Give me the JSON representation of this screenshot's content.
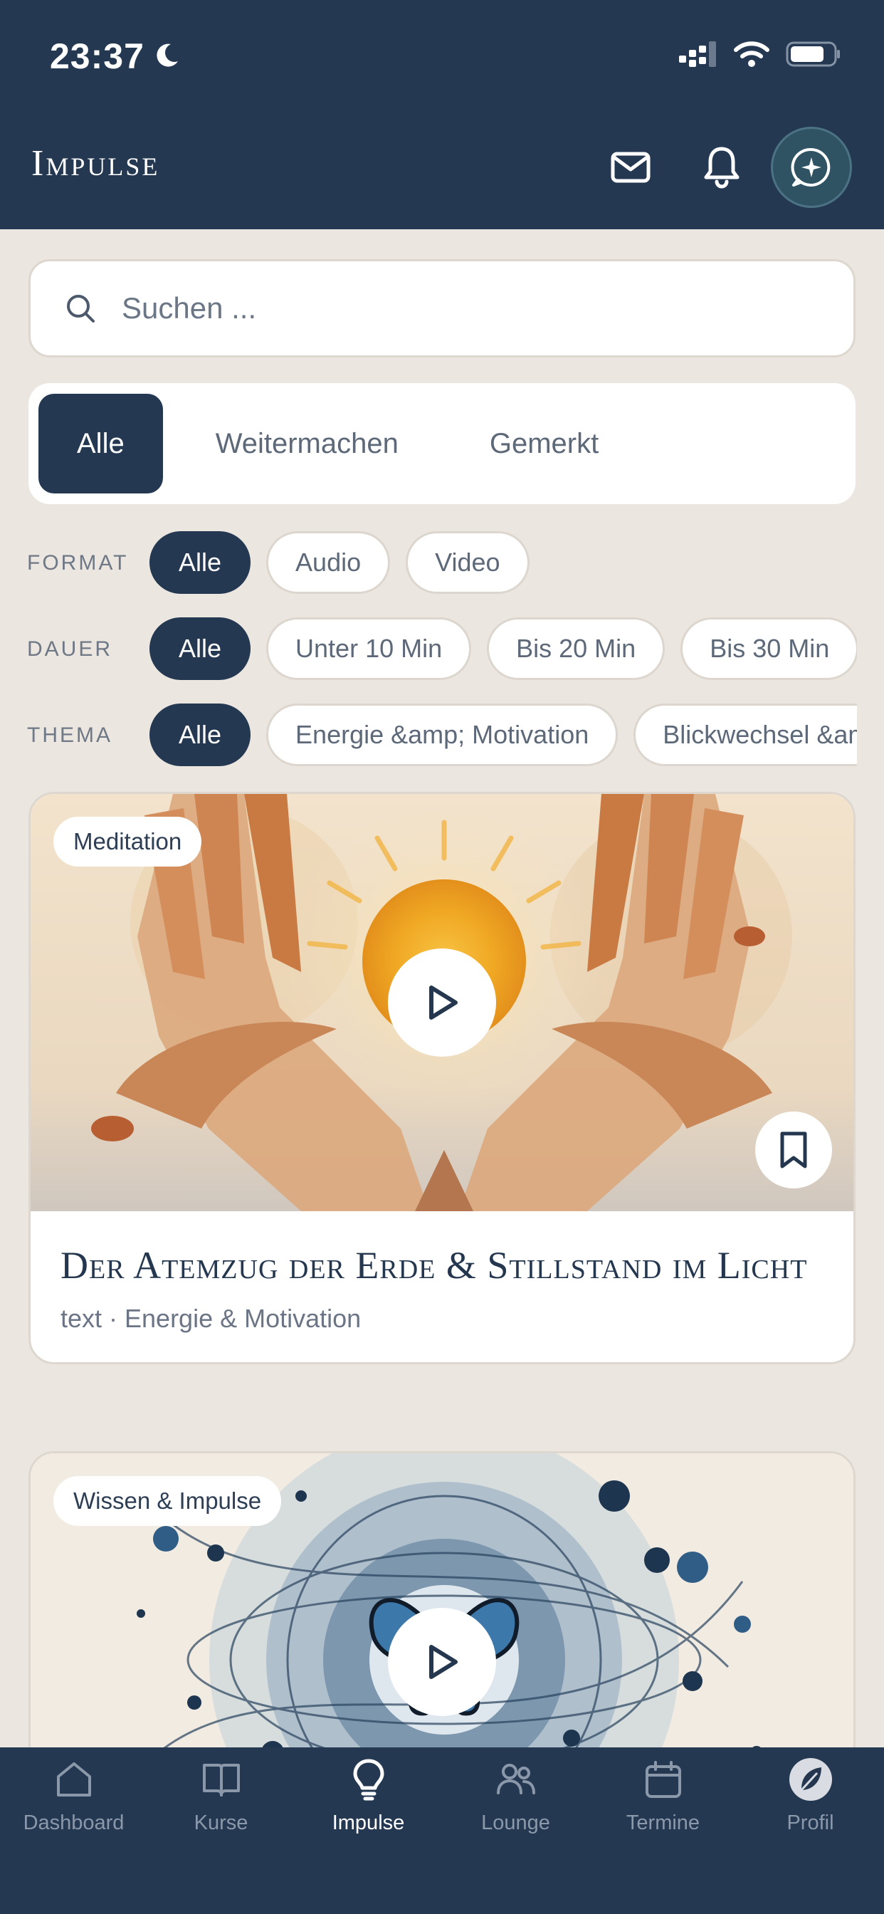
{
  "status_bar": {
    "time": "23:37"
  },
  "header": {
    "title": "Impulse"
  },
  "search": {
    "placeholder": "Suchen ..."
  },
  "tabs": [
    {
      "label": "Alle",
      "active": true
    },
    {
      "label": "Weitermachen",
      "active": false
    },
    {
      "label": "Gemerkt",
      "active": false
    }
  ],
  "filters": {
    "format": {
      "label": "FORMAT",
      "options": [
        "Alle",
        "Audio",
        "Video"
      ],
      "selected": "Alle"
    },
    "dauer": {
      "label": "DAUER",
      "options": [
        "Alle",
        "Unter 10 Min",
        "Bis 20 Min",
        "Bis 30 Min"
      ],
      "selected": "Alle"
    },
    "thema": {
      "label": "THEMA",
      "options": [
        "Alle",
        "Energie &amp; Motivation",
        "Blickwechsel &am"
      ],
      "selected": "Alle"
    }
  },
  "cards": [
    {
      "badge": "Meditation",
      "title": "Der Atemzug der Erde & Stillstand im Licht",
      "meta": "text · Energie & Motivation",
      "icons": [
        "play-icon",
        "bookmark-icon"
      ]
    },
    {
      "badge": "Wissen & Impulse",
      "icons": [
        "play-icon"
      ]
    }
  ],
  "bottom_nav": [
    {
      "label": "Dashboard",
      "icon": "home-icon",
      "active": false
    },
    {
      "label": "Kurse",
      "icon": "book-icon",
      "active": false
    },
    {
      "label": "Impulse",
      "icon": "lightbulb-icon",
      "active": true
    },
    {
      "label": "Lounge",
      "icon": "users-icon",
      "active": false
    },
    {
      "label": "Termine",
      "icon": "calendar-icon",
      "active": false
    },
    {
      "label": "Profil",
      "icon": "leaf-avatar-icon",
      "active": false
    }
  ],
  "colors": {
    "primary": "#243852",
    "background": "#ebe6df",
    "card": "#ffffff",
    "assistant_button": "#2f5363"
  }
}
